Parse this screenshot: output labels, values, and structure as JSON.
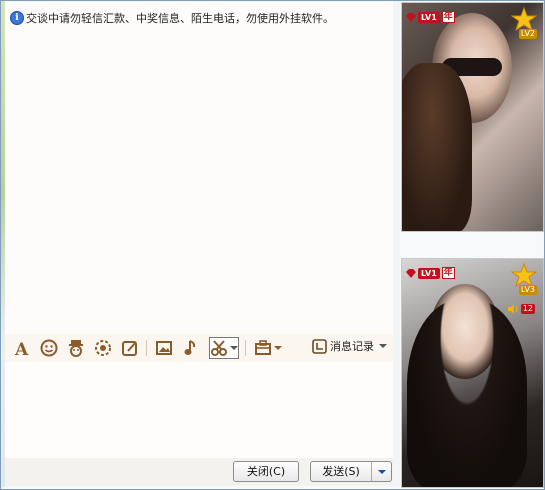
{
  "notice": "交谈中请勿轻信汇款、中奖信息、陌生电话，勿使用外挂软件。",
  "toolbar": {
    "history_label": "消息记录"
  },
  "buttons": {
    "close_label": "关闭(C)",
    "send_label": "发送(S)"
  },
  "profiles": [
    {
      "level_badge": "LV1",
      "year_badge": "年",
      "star_level": "LV2"
    },
    {
      "level_badge": "LV1",
      "year_badge": "年",
      "star_level": "LV3",
      "volume_count": "12"
    }
  ],
  "colors": {
    "toolbar_icon": "#8a5c2c",
    "badge_red": "#c1121b",
    "info_blue": "#3a77d6"
  }
}
